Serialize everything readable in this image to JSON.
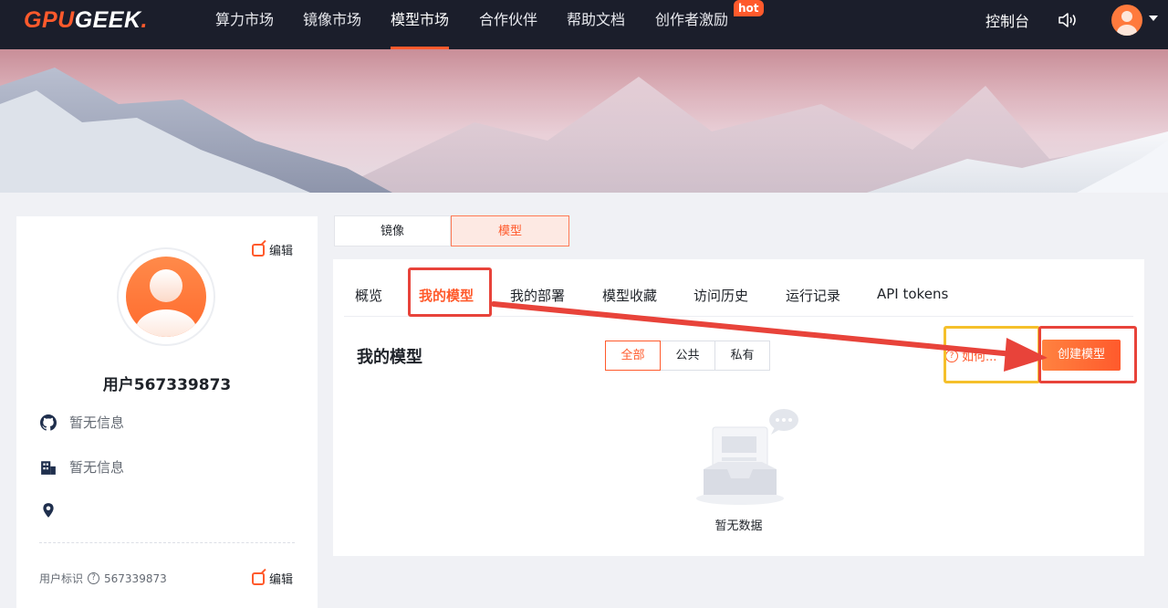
{
  "topnav": {
    "logo_gpu": "GPU",
    "logo_geek": "GEEK",
    "logo_dot": ".",
    "items": [
      {
        "label": "算力市场"
      },
      {
        "label": "镜像市场"
      },
      {
        "label": "模型市场"
      },
      {
        "label": "合作伙伴"
      },
      {
        "label": "帮助文档"
      },
      {
        "label": "创作者激励"
      }
    ],
    "hot_badge": "hot",
    "console": "控制台",
    "sound_icon": "speaker-icon",
    "avatar_icon": "user-avatar-icon"
  },
  "profile": {
    "edit": "编辑",
    "username": "用户567339873",
    "github": "暂无信息",
    "company": "暂无信息",
    "location": "",
    "uid_label": "用户标识",
    "uid_value": "567339873",
    "uid_edit": "编辑"
  },
  "segment": {
    "mirror": "镜像",
    "model": "模型"
  },
  "tabs": [
    {
      "label": "概览"
    },
    {
      "label": "我的模型"
    },
    {
      "label": "我的部署"
    },
    {
      "label": "模型收藏"
    },
    {
      "label": "访问历史"
    },
    {
      "label": "运行记录"
    },
    {
      "label": "API tokens"
    }
  ],
  "section": {
    "title": "我的模型",
    "filters": [
      {
        "label": "全部"
      },
      {
        "label": "公共"
      },
      {
        "label": "私有"
      }
    ],
    "howto": "如何...",
    "create": "创建模型",
    "empty": "暂无数据"
  },
  "colors": {
    "brand": "#ff5a2c",
    "nav_bg": "#1b1e2b",
    "annotation_red": "#e8433a",
    "annotation_yellow": "#f5c02b"
  }
}
